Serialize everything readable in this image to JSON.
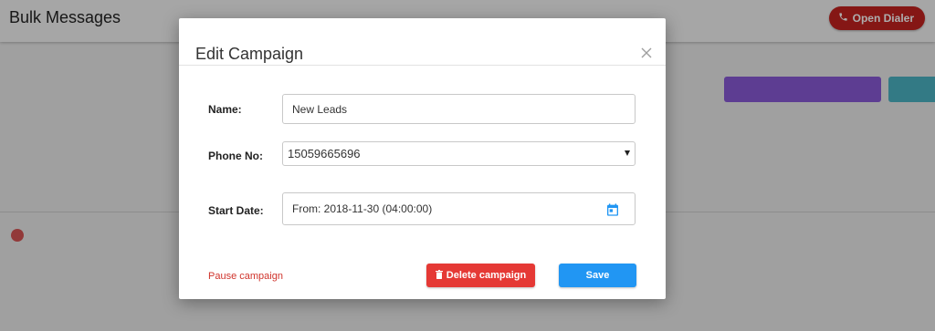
{
  "app": {
    "title": "Bulk Messages",
    "open_dialer_label": "Open Dialer"
  },
  "modal": {
    "title": "Edit Campaign",
    "name_label": "Name:",
    "name_value": "New Leads",
    "phone_label": "Phone No:",
    "phone_value": "15059665696",
    "start_date_label": "Start Date:",
    "start_date_value": "From: 2018-11-30 (04:00:00)",
    "pause_label": "Pause campaign",
    "delete_label": "Delete campaign",
    "save_label": "Save"
  },
  "colors": {
    "danger": "#e53935",
    "primary": "#2196f3",
    "dialer": "#c5221f",
    "link_red": "#d0342c"
  },
  "icons": [
    "phone-icon",
    "close-icon",
    "calendar-icon",
    "trash-icon",
    "select-caret-icon"
  ]
}
